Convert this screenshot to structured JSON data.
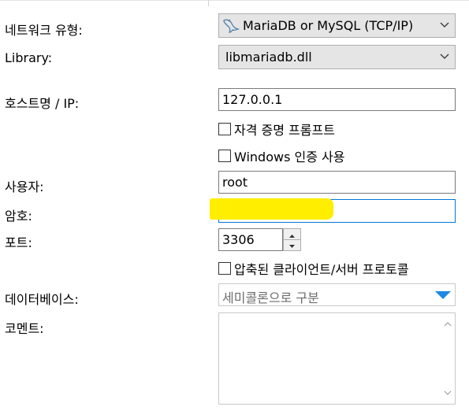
{
  "form": {
    "network_type": {
      "label": "네트워크 유형:",
      "value": "MariaDB or MySQL (TCP/IP)",
      "icon": "dolphin-icon"
    },
    "library": {
      "label": "Library:",
      "value": "libmariadb.dll"
    },
    "host": {
      "label": "호스트명 / IP:",
      "value": "127.0.0.1"
    },
    "checkboxes": {
      "credential_prompt": "자격 증명 프롬프트",
      "windows_auth": "Windows 인증 사용"
    },
    "user": {
      "label": "사용자:",
      "value": "root"
    },
    "password": {
      "label": "암호:",
      "value": ""
    },
    "port": {
      "label": "포트:",
      "value": "3306"
    },
    "compressed": "압축된 클라이언트/서버 프로토콜",
    "databases": {
      "label": "데이터베이스:",
      "placeholder": "세미콜론으로 구분"
    },
    "comment": {
      "label": "코멘트:",
      "value": ""
    }
  },
  "colors": {
    "highlight": "#ffff00",
    "focus_border": "#0078d7",
    "dropdown_arrow": "#1e88e5"
  }
}
